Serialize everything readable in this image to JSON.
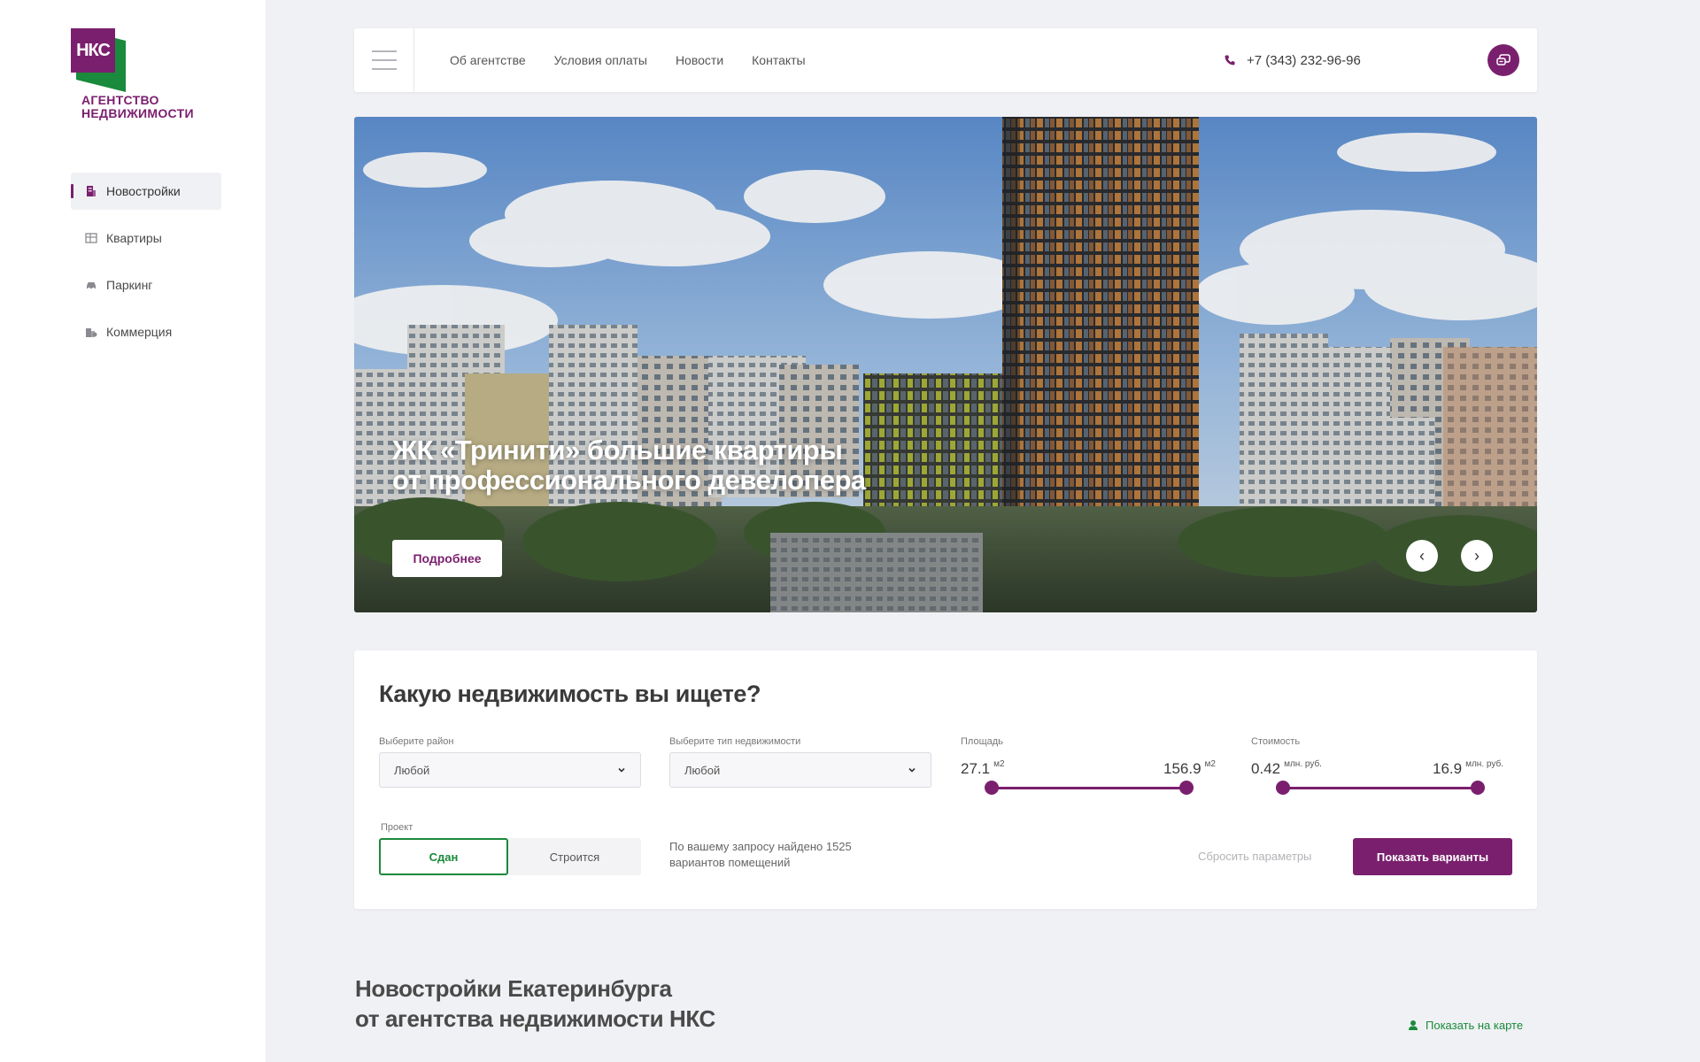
{
  "brand": {
    "logo_letters": "НКС",
    "line1": "АГЕНТСТВО",
    "line2": "НЕДВИЖИМОСТИ",
    "colors": {
      "purple": "#7a1f6e",
      "green": "#1a8a3c"
    }
  },
  "sidebar": {
    "items": [
      {
        "label": "Новостройки",
        "icon": "building-icon",
        "active": true
      },
      {
        "label": "Квартиры",
        "icon": "apartment-icon",
        "active": false
      },
      {
        "label": "Паркинг",
        "icon": "car-icon",
        "active": false
      },
      {
        "label": "Коммерция",
        "icon": "commerce-icon",
        "active": false
      }
    ]
  },
  "header": {
    "links": [
      "Об агентстве",
      "Условия оплаты",
      "Новости",
      "Контакты"
    ],
    "phone": "+7 (343) 232-96-96"
  },
  "hero": {
    "title_line1": "ЖК «Тринити» большие квартиры",
    "title_line2": "от профессионального девелопера",
    "button": "Подробнее",
    "prev": "‹",
    "next": "›"
  },
  "search": {
    "title": "Какую недвижимость вы ищете?",
    "district_label": "Выберите район",
    "district_value": "Любой",
    "type_label": "Выберите тип недвижимости",
    "type_value": "Любой",
    "area_label": "Площадь",
    "area_min": "27.1",
    "area_max": "156.9",
    "area_unit": "м2",
    "price_label": "Стоимость",
    "price_min": "0.42",
    "price_max": "16.9",
    "price_unit": "млн. руб.",
    "project_label": "Проект",
    "project_done": "Сдан",
    "project_building": "Строится",
    "found_line1": "По вашему запросу найдено 1525",
    "found_line2": "вариантов помещений",
    "reset": "Сбросить параметры",
    "show": "Показать варианты"
  },
  "section": {
    "title_line1": "Новостройки Екатеринбурга",
    "title_line2": "от агентства недвижимости НКС",
    "map_link": "Показать на карте"
  }
}
